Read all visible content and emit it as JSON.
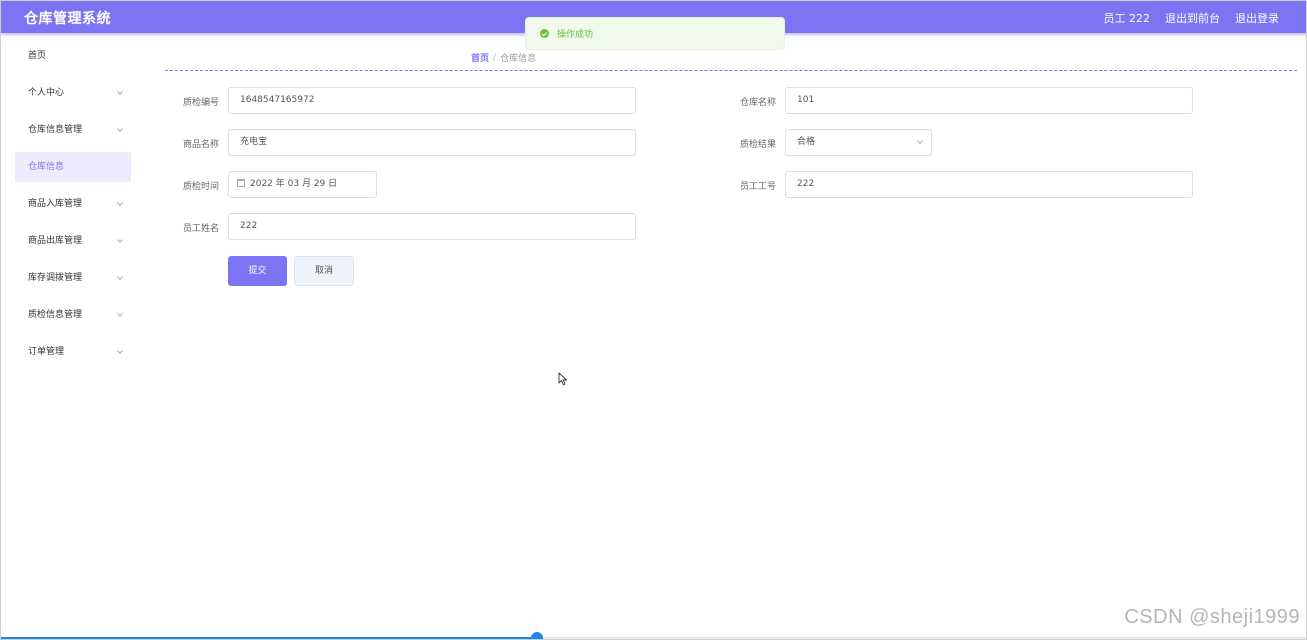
{
  "header": {
    "title": "仓库管理系统",
    "user_label": "员工 222",
    "back_to_front": "退出到前台",
    "logout": "退出登录"
  },
  "toast": {
    "message": "操作成功"
  },
  "sidebar": {
    "items": [
      {
        "label": "首页",
        "expandable": false
      },
      {
        "label": "个人中心",
        "expandable": true
      },
      {
        "label": "仓库信息管理",
        "expandable": true
      },
      {
        "label": "仓库信息",
        "expandable": false,
        "active": true
      },
      {
        "label": "商品入库管理",
        "expandable": true
      },
      {
        "label": "商品出库管理",
        "expandable": true
      },
      {
        "label": "库存调拨管理",
        "expandable": true
      },
      {
        "label": "质检信息管理",
        "expandable": true
      },
      {
        "label": "订单管理",
        "expandable": true
      }
    ]
  },
  "breadcrumb": {
    "home": "首页",
    "separator": "/",
    "current": "仓库信息"
  },
  "form": {
    "inspection_no": {
      "label": "质检编号",
      "value": "1648547165972"
    },
    "warehouse_name": {
      "label": "仓库名称",
      "value": "101"
    },
    "product_name": {
      "label": "商品名称",
      "value": "充电宝"
    },
    "inspection_result": {
      "label": "质检结果",
      "value": "合格"
    },
    "inspection_time": {
      "label": "质检时间",
      "value": "2022 年 03 月 29 日"
    },
    "employee_no": {
      "label": "员工工号",
      "value": "222"
    },
    "employee_name": {
      "label": "员工姓名",
      "value": "222"
    },
    "submit_label": "提交",
    "cancel_label": "取消"
  },
  "watermark": "CSDN @sheji1999",
  "progress": {
    "fraction": 0.41
  },
  "colors": {
    "accent": "#7b75f4",
    "success": "#67c23a",
    "progress": "#1e88e5"
  }
}
